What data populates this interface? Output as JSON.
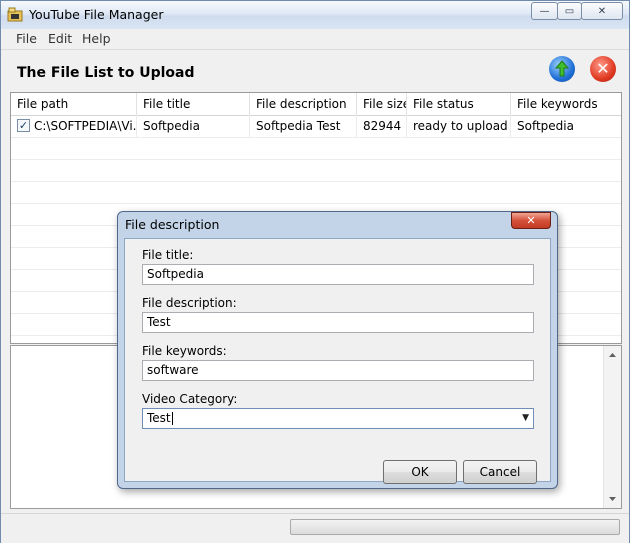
{
  "window": {
    "title": "YouTube File Manager",
    "min_glyph": "—",
    "max_glyph": "▭",
    "close_glyph": "✕"
  },
  "menu": {
    "items": [
      "File",
      "Edit",
      "Help"
    ]
  },
  "header": {
    "title": "The File List to Upload",
    "close_glyph": "✕"
  },
  "table": {
    "columns": [
      "File path",
      "File title",
      "File description",
      "File size",
      "File status",
      "File keywords"
    ],
    "rows": [
      {
        "checked": true,
        "check_glyph": "✓",
        "path": "C:\\SOFTPEDIA\\Vi...",
        "title": "Softpedia",
        "description": "Softpedia Test",
        "size": "82944",
        "status": "ready to upload",
        "keywords": "Softpedia"
      }
    ]
  },
  "dialog": {
    "title": "File description",
    "close_glyph": "✕",
    "fields": {
      "title_label": "File title:",
      "title_value": "Softpedia",
      "description_label": "File description:",
      "description_value": "Test",
      "keywords_label": "File keywords:",
      "keywords_value": "software",
      "category_label": "Video Category:",
      "category_value": "Test"
    },
    "ok_label": "OK",
    "cancel_label": "Cancel"
  },
  "icons": {
    "app": "folder-video-icon",
    "upload": "globe-upload-icon",
    "close": "red-x-icon",
    "dropdown": "chevron-down-icon"
  },
  "colors": {
    "titlebar": "#dfe9f5",
    "dialog_frame": "#c3d4e8",
    "close_red": "#c23a22"
  }
}
